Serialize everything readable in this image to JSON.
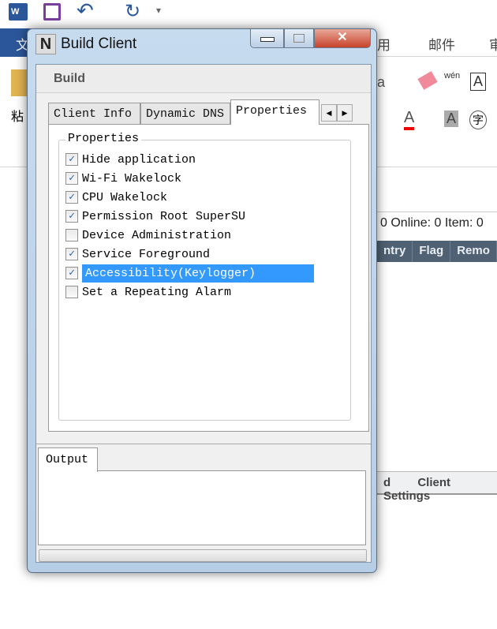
{
  "word": {
    "file_tab": "文",
    "tabs": [
      "用",
      "邮件",
      "审"
    ],
    "ribbon_glyphs": [
      "粘",
      "a",
      "wén",
      "A",
      "A",
      "A",
      "字"
    ],
    "accent": "#2b579a"
  },
  "background_app": {
    "status": "0 Online: 0 Item: 0",
    "columns": [
      "ntry",
      "Flag",
      "Remo"
    ],
    "bottom_tabs": "d Client Settings"
  },
  "dialog": {
    "title": "Build Client",
    "logo": "N",
    "section": "Build",
    "tabs": [
      "Client Info",
      "Dynamic DNS",
      "Properties"
    ],
    "active_tab": "Properties",
    "group_label": "Properties",
    "items": [
      {
        "label": "Hide application",
        "checked": true
      },
      {
        "label": "Wi-Fi Wakelock",
        "checked": true
      },
      {
        "label": "CPU Wakelock",
        "checked": true
      },
      {
        "label": "Permission Root SuperSU",
        "checked": true
      },
      {
        "label": "Device Administration",
        "checked": false
      },
      {
        "label": "Service Foreground",
        "checked": true
      },
      {
        "label": "Accessibility(Keylogger)",
        "checked": true,
        "selected": true
      },
      {
        "label": "Set a Repeating Alarm",
        "checked": false
      }
    ],
    "output_tab": "Output",
    "progress": 0,
    "selection_color": "#3399ff"
  }
}
